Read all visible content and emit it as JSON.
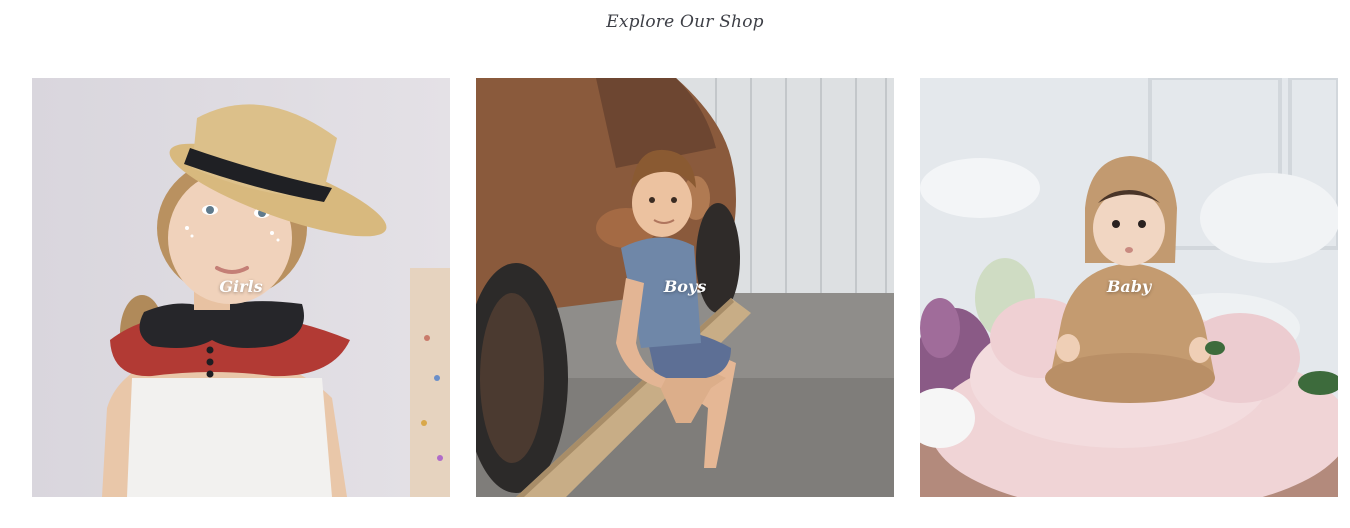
{
  "section": {
    "title": "Explore Our Shop"
  },
  "categories": [
    {
      "label": "Girls",
      "image": "girl-in-straw-boater-hat-photo"
    },
    {
      "label": "Boys",
      "image": "boy-sitting-by-vintage-car-photo"
    },
    {
      "label": "Baby",
      "image": "baby-on-pink-fur-rug-photo"
    }
  ],
  "colors": {
    "title_text": "#3d3f46",
    "label_text": "#ffffff",
    "background": "#ffffff"
  }
}
